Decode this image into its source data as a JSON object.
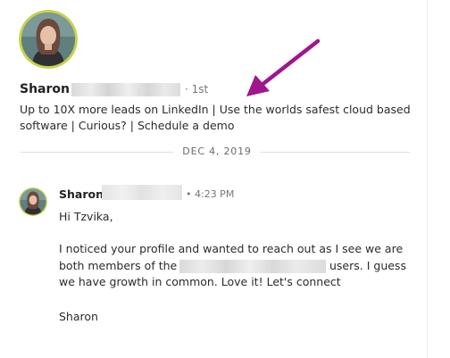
{
  "profile": {
    "name": "Sharon",
    "degree": "· 1st",
    "headline": "Up to 10X more leads on LinkedIn | Use the worlds safest cloud based software | Curious? | Schedule a demo"
  },
  "divider": {
    "date": "DEC 4, 2019"
  },
  "message": {
    "sender": "Sharon",
    "time": "• 4:23 PM",
    "greeting": "Hi Tzvika,",
    "line1": "I noticed your profile and wanted to reach out as I see we are",
    "line2_pre": "both members of the",
    "line2_post": "users. I guess",
    "line3": "we have growth in common. Love it! Let's connect",
    "signature": "Sharon"
  },
  "colors": {
    "arrow": "#a0168c",
    "avatar_ring": "#c9d24a"
  },
  "icons": {
    "annotation": "arrow-icon"
  }
}
